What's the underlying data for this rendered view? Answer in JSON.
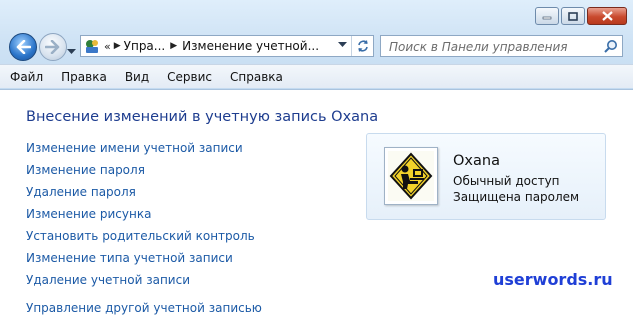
{
  "window": {
    "minimize_icon": "minimize-icon",
    "maximize_icon": "maximize-icon",
    "close_icon": "close-icon"
  },
  "navigation": {
    "back_icon": "back-arrow-icon",
    "forward_icon": "forward-arrow-icon",
    "recent_icon": "chevron-down-icon"
  },
  "address_bar": {
    "overflow": "«",
    "segments": [
      "Упра...",
      "Изменение учетной..."
    ],
    "separator": "▶",
    "refresh_icon": "refresh-icon"
  },
  "search": {
    "placeholder": "Поиск в Панели управления",
    "icon": "search-icon"
  },
  "menu": {
    "items": [
      "Файл",
      "Правка",
      "Вид",
      "Сервис",
      "Справка"
    ]
  },
  "main": {
    "heading": "Внесение изменений в учетную запись Oxana",
    "links": [
      "Изменение имени учетной записи",
      "Изменение пароля",
      "Удаление пароля",
      "Изменение рисунка",
      "Установить родительский контроль",
      "Изменение типа учетной записи",
      "Удаление учетной записи",
      "Управление другой учетной записью"
    ]
  },
  "account_card": {
    "name": "Oxana",
    "type": "Обычный доступ",
    "status": "Защищена паролем"
  },
  "watermark": "userwords.ru",
  "colors": {
    "link": "#1c5aa6",
    "heading": "#1e3d8f",
    "watermark": "#1f3fd6"
  }
}
